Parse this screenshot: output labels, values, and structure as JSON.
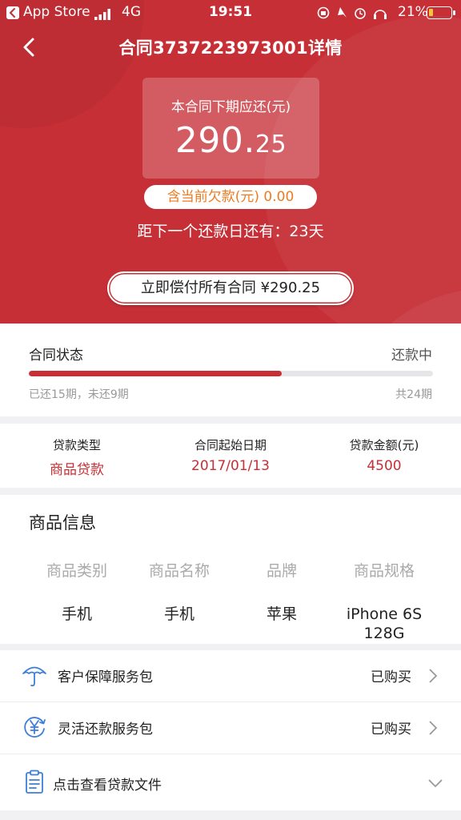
{
  "status_bar": {
    "carrier": "App Store",
    "network": "4G",
    "time": "19:51",
    "battery": "21%",
    "battery_level": 0.21
  },
  "header": {
    "title": "合同3737223973001详情"
  },
  "due": {
    "label": "本合同下期应还(元)",
    "amount_int": "290.",
    "amount_dec": "25"
  },
  "arrears": {
    "text": "含当前欠款(元)  0.00"
  },
  "countdown": {
    "text": "距下一个还款日还有：23天"
  },
  "pay_all": {
    "label": "立即偿付所有合同 ¥290.25"
  },
  "contract_status": {
    "label": "合同状态",
    "value": "还款中",
    "progress": 0.625,
    "paid_text": "已还15期，未还9期",
    "total_text": "共24期"
  },
  "loan_facts": [
    {
      "key": "贷款类型",
      "value": "商品贷款"
    },
    {
      "key": "合同起始日期",
      "value": "2017/01/13"
    },
    {
      "key": "贷款金额(元)",
      "value": "4500"
    }
  ],
  "product": {
    "title": "商品信息",
    "headers": [
      "商品类别",
      "商品名称",
      "品牌",
      "商品规格"
    ],
    "values": [
      "手机",
      "手机",
      "苹果",
      "iPhone 6S 128G"
    ]
  },
  "services": [
    {
      "name": "客户保障服务包",
      "state": "已购买",
      "icon": "umbrella-icon"
    },
    {
      "name": "灵活还款服务包",
      "state": "已购买",
      "icon": "yen-cycle-icon"
    }
  ],
  "documents": {
    "label": "点击查看贷款文件",
    "icon": "clipboard-icon"
  },
  "colors": {
    "primary_red": "#c62f36",
    "arrears_orange": "#ef7a1f",
    "icon_blue": "#3d7fd6"
  }
}
